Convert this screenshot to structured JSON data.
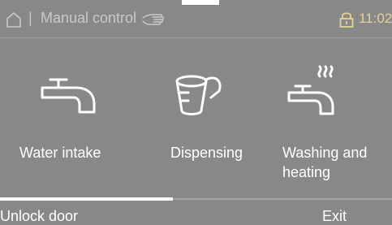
{
  "status_bar": {
    "separator": "|",
    "title": "Manual control",
    "time": "11:02",
    "icons": {
      "home": "home-icon",
      "hand": "hand-icon",
      "lock": "lock-icon"
    },
    "time_color": "#e6d290"
  },
  "tiles": [
    {
      "label": "Water intake",
      "icon": "tap-icon"
    },
    {
      "label": "Dispensing",
      "icon": "measuring-cup-icon"
    },
    {
      "label": "Washing and heating",
      "icon": "heated-tap-icon"
    }
  ],
  "softkeys": {
    "left": "Unlock door",
    "right": "Exit"
  },
  "colors": {
    "background": "#888888",
    "foreground": "#ffffff",
    "muted_text": "#c9c9c9"
  }
}
